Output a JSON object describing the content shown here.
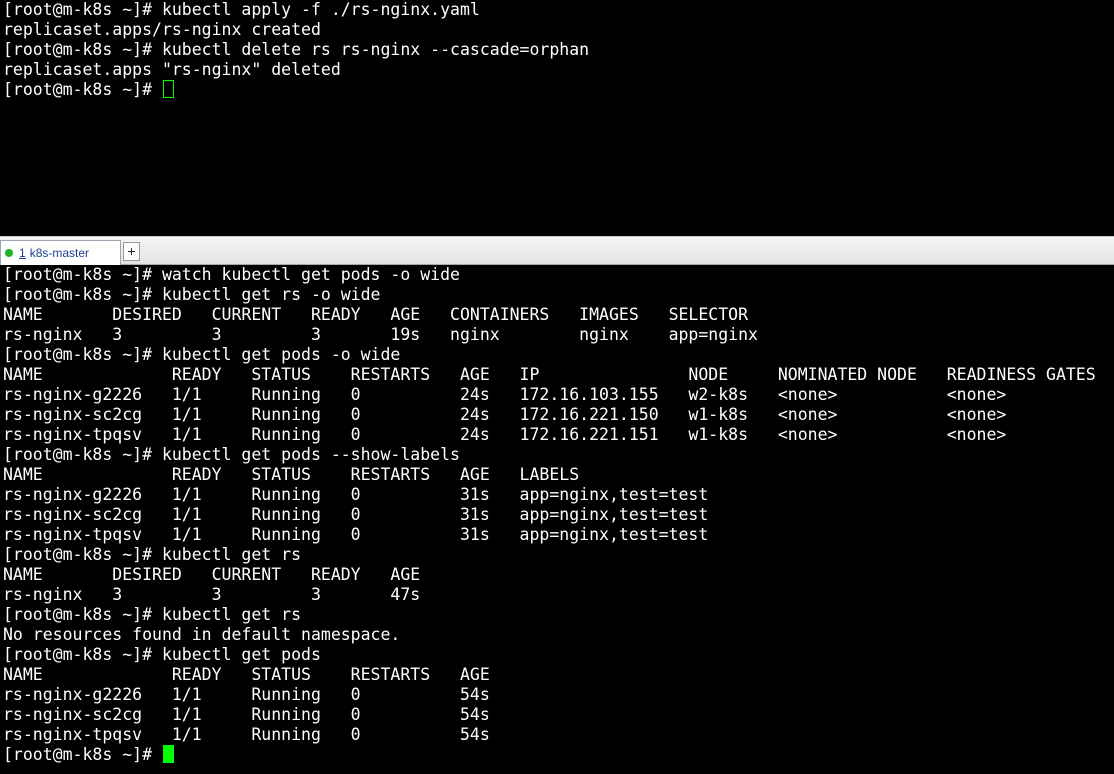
{
  "top_pane": {
    "lines": [
      "[root@m-k8s ~]# kubectl apply -f ./rs-nginx.yaml",
      "replicaset.apps/rs-nginx created",
      "[root@m-k8s ~]# kubectl delete rs rs-nginx --cascade=orphan",
      "replicaset.apps \"rs-nginx\" deleted",
      "[root@m-k8s ~]# "
    ]
  },
  "tab_bar": {
    "tab": {
      "number": "1",
      "label": "k8s-master"
    },
    "new_tab": "+"
  },
  "bottom_pane": {
    "lines": [
      "[root@m-k8s ~]# watch kubectl get pods -o wide",
      "[root@m-k8s ~]# kubectl get rs -o wide",
      "NAME       DESIRED   CURRENT   READY   AGE   CONTAINERS   IMAGES   SELECTOR",
      "rs-nginx   3         3         3       19s   nginx        nginx    app=nginx",
      "[root@m-k8s ~]# kubectl get pods -o wide",
      "NAME             READY   STATUS    RESTARTS   AGE   IP               NODE     NOMINATED NODE   READINESS GATES",
      "rs-nginx-g2226   1/1     Running   0          24s   172.16.103.155   w2-k8s   <none>           <none>",
      "rs-nginx-sc2cg   1/1     Running   0          24s   172.16.221.150   w1-k8s   <none>           <none>",
      "rs-nginx-tpqsv   1/1     Running   0          24s   172.16.221.151   w1-k8s   <none>           <none>",
      "[root@m-k8s ~]# kubectl get pods --show-labels",
      "NAME             READY   STATUS    RESTARTS   AGE   LABELS",
      "rs-nginx-g2226   1/1     Running   0          31s   app=nginx,test=test",
      "rs-nginx-sc2cg   1/1     Running   0          31s   app=nginx,test=test",
      "rs-nginx-tpqsv   1/1     Running   0          31s   app=nginx,test=test",
      "[root@m-k8s ~]# kubectl get rs",
      "NAME       DESIRED   CURRENT   READY   AGE",
      "rs-nginx   3         3         3       47s",
      "[root@m-k8s ~]# kubectl get rs",
      "No resources found in default namespace.",
      "[root@m-k8s ~]# kubectl get pods",
      "NAME             READY   STATUS    RESTARTS   AGE",
      "rs-nginx-g2226   1/1     Running   0          54s",
      "rs-nginx-sc2cg   1/1     Running   0          54s",
      "rs-nginx-tpqsv   1/1     Running   0          54s",
      "[root@m-k8s ~]# "
    ]
  },
  "colors": {
    "background": "#000000",
    "foreground": "#ffffff",
    "cursor": "#00ff00",
    "tab_status_dot": "#22b322"
  }
}
